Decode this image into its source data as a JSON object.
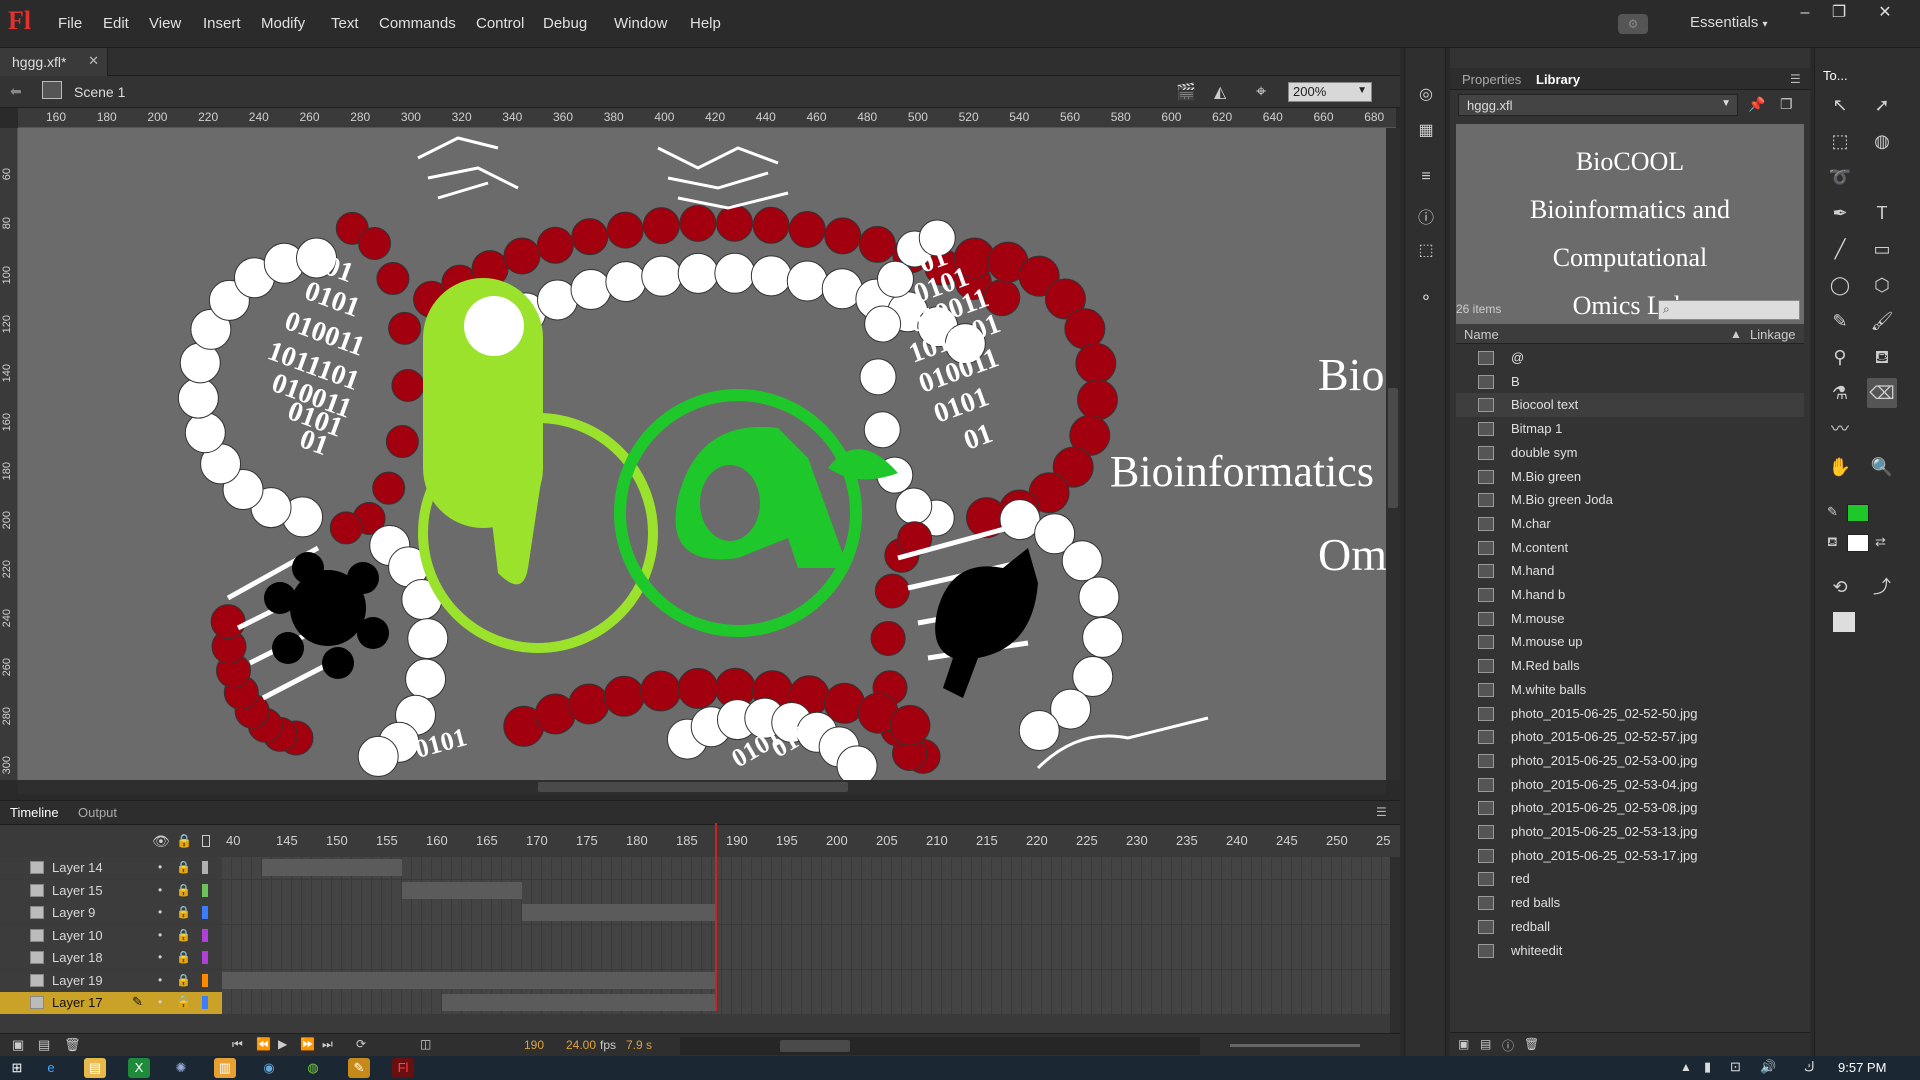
{
  "app": {
    "logo": "Fl",
    "workspace": "Essentials"
  },
  "menu": [
    "File",
    "Edit",
    "View",
    "Insert",
    "Modify",
    "Text",
    "Commands",
    "Control",
    "Debug",
    "Window",
    "Help"
  ],
  "document": {
    "tab": "hggg.xfl*",
    "scene": "Scene 1",
    "zoom": "200%"
  },
  "ruler_top": [
    "160",
    "180",
    "200",
    "220",
    "240",
    "260",
    "280",
    "300",
    "320",
    "340",
    "360",
    "380",
    "400",
    "420",
    "440",
    "460",
    "480",
    "500",
    "520",
    "540",
    "560",
    "580",
    "600",
    "620",
    "640",
    "660",
    "680"
  ],
  "ruler_left": [
    "60",
    "80",
    "100",
    "120",
    "140",
    "160",
    "180",
    "200",
    "220",
    "240",
    "260",
    "280",
    "300"
  ],
  "stage": {
    "binary_left": [
      "01",
      "0101",
      "010011",
      "1011101",
      "010011",
      "0101",
      "01"
    ],
    "binary_right": [
      "01",
      "0101",
      "010011",
      "1011101",
      "010011",
      "0101",
      "01"
    ],
    "binary_bottom": [
      "0101",
      "0101",
      "0101"
    ],
    "text_bio": "Bio",
    "text_bioinf": "Bioinformatics a",
    "text_om": "Om",
    "colors": {
      "stage": "#6b6b6b",
      "green_light": "#9be22d",
      "green_dark": "#1fc82a",
      "red": "#a2000f",
      "white": "#ffffff"
    }
  },
  "timeline": {
    "tabs": [
      "Timeline",
      "Output"
    ],
    "frame_numbers": [
      "40",
      "145",
      "150",
      "155",
      "160",
      "165",
      "170",
      "175",
      "180",
      "185",
      "190",
      "195",
      "200",
      "205",
      "210",
      "215",
      "220",
      "225",
      "230",
      "235",
      "240",
      "245",
      "250",
      "25"
    ],
    "layers": [
      {
        "name": "Layer 14",
        "color": "#b0b0b0"
      },
      {
        "name": "Layer 15",
        "color": "#6ec25a"
      },
      {
        "name": "Layer 9",
        "color": "#3d7cff"
      },
      {
        "name": "Layer 10",
        "color": "#b140d8"
      },
      {
        "name": "Layer 18",
        "color": "#b140d8"
      },
      {
        "name": "Layer 19",
        "color": "#ff8a00"
      },
      {
        "name": "Layer 17",
        "color": "#3d7cff"
      }
    ],
    "current_frame": "190",
    "fps": "24.00",
    "fps_unit": "fps",
    "time": "7.9 s"
  },
  "panels": {
    "properties": "Properties",
    "library": "Library",
    "tools": "To..."
  },
  "library": {
    "document": "hggg.xfl",
    "preview_lines": [
      "BioCOOL",
      "Bioinformatics and Computational",
      "Omics Lab"
    ],
    "count": "26 items",
    "col_name": "Name",
    "col_linkage": "Linkage",
    "items": [
      "@",
      "B",
      "Biocool text",
      "Bitmap 1",
      "double sym",
      "M.Bio green",
      "M.Bio green Joda",
      "M.char",
      "M.content",
      "M.hand",
      "M.hand b",
      "M.mouse",
      "M.mouse up",
      "M.Red balls",
      "M.white balls",
      "photo_2015-06-25_02-52-50.jpg",
      "photo_2015-06-25_02-52-57.jpg",
      "photo_2015-06-25_02-53-00.jpg",
      "photo_2015-06-25_02-53-04.jpg",
      "photo_2015-06-25_02-53-08.jpg",
      "photo_2015-06-25_02-53-13.jpg",
      "photo_2015-06-25_02-53-17.jpg",
      "red",
      "red balls",
      "redball",
      "whiteedit"
    ],
    "selected_index": 2
  },
  "tool_colors": {
    "stroke": "#1fc82a",
    "fill": "#ffffff"
  },
  "taskbar": {
    "time": "9:57 PM"
  }
}
